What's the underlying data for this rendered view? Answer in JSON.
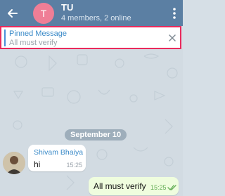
{
  "header": {
    "title": "TU",
    "subtitle": "4 members, 2 online",
    "avatar_letter": "T",
    "avatar_color": "#ef7e96",
    "bar_color": "#5b7fa3"
  },
  "pinned": {
    "label": "Pinned Message",
    "text": "All must verify",
    "highlight_color": "#ea2a5c"
  },
  "chat": {
    "date_label": "September 10",
    "incoming": {
      "sender": "Shivam Bhaiya",
      "text": "hi",
      "time": "15:25"
    },
    "outgoing": {
      "text": "All must verify",
      "time": "15:25",
      "status_icon": "double-check-icon"
    }
  }
}
